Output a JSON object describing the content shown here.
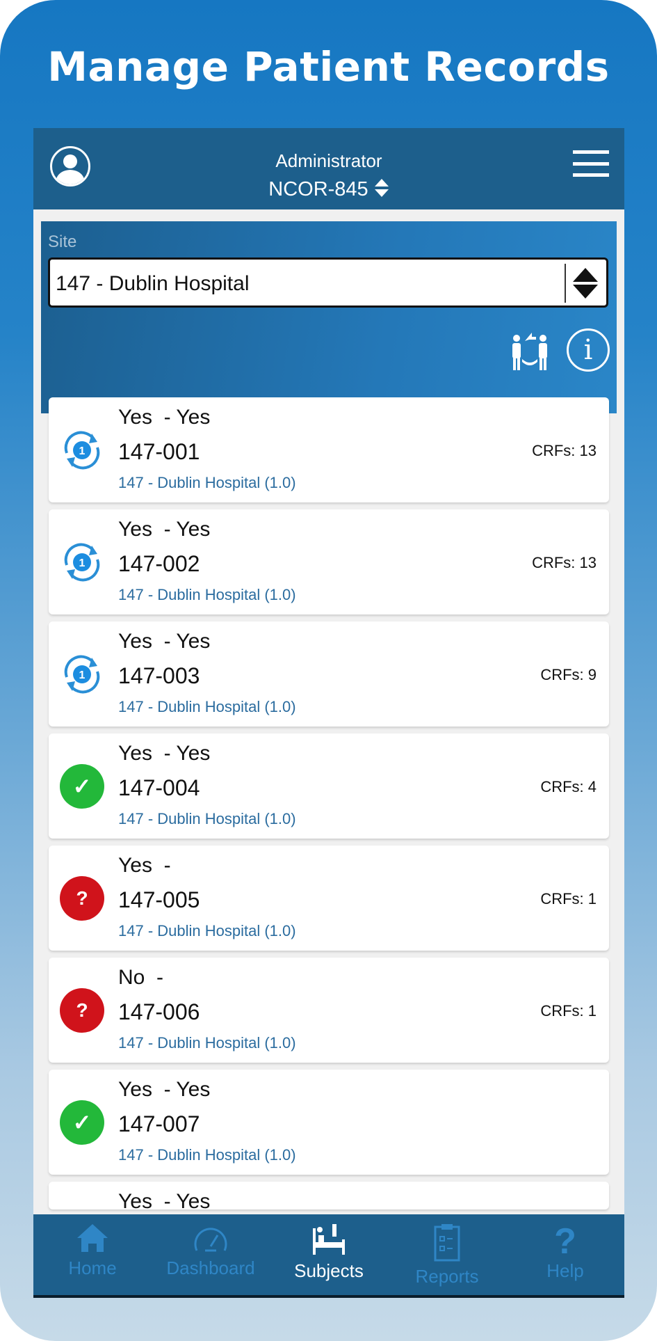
{
  "banner_title": "Manage Patient Records",
  "header": {
    "role": "Administrator",
    "study": "NCOR-845"
  },
  "site": {
    "label": "Site",
    "value": "147 - Dublin Hospital"
  },
  "subjects": [
    {
      "line1": "Yes  - Yes",
      "id": "147-001",
      "site": "147 - Dublin Hospital (1.0)",
      "crfs": "CRFs: 13",
      "status": "sync",
      "badge": "1"
    },
    {
      "line1": "Yes  - Yes",
      "id": "147-002",
      "site": "147 - Dublin Hospital (1.0)",
      "crfs": "CRFs: 13",
      "status": "sync",
      "badge": "1"
    },
    {
      "line1": "Yes  - Yes",
      "id": "147-003",
      "site": "147 - Dublin Hospital (1.0)",
      "crfs": "CRFs: 9",
      "status": "sync",
      "badge": "1"
    },
    {
      "line1": "Yes  - Yes",
      "id": "147-004",
      "site": "147 - Dublin Hospital (1.0)",
      "crfs": "CRFs: 4",
      "status": "complete",
      "badge": "✓"
    },
    {
      "line1": "Yes  -",
      "id": "147-005",
      "site": "147 - Dublin Hospital (1.0)",
      "crfs": "CRFs: 1",
      "status": "query",
      "badge": "?"
    },
    {
      "line1": "No  -",
      "id": "147-006",
      "site": "147 - Dublin Hospital (1.0)",
      "crfs": "CRFs: 1",
      "status": "query",
      "badge": "?"
    },
    {
      "line1": "Yes  - Yes",
      "id": "147-007",
      "site": "147 - Dublin Hospital (1.0)",
      "crfs": "",
      "status": "complete",
      "badge": "✓"
    },
    {
      "line1": "Yes  - Yes"
    }
  ],
  "fab": "+",
  "nav": [
    {
      "label": "Home",
      "icon": "home-icon"
    },
    {
      "label": "Dashboard",
      "icon": "speedometer-icon"
    },
    {
      "label": "Subjects",
      "icon": "patient-bed-icon",
      "active": true
    },
    {
      "label": "Reports",
      "icon": "clipboard-icon"
    },
    {
      "label": "Help",
      "icon": "question-icon"
    }
  ],
  "colors": {
    "header": "#1d5f8c",
    "accent": "#2b6c9f",
    "ok": "#23b83a",
    "query": "#d0131b",
    "nav_inactive": "#2f86c6"
  }
}
